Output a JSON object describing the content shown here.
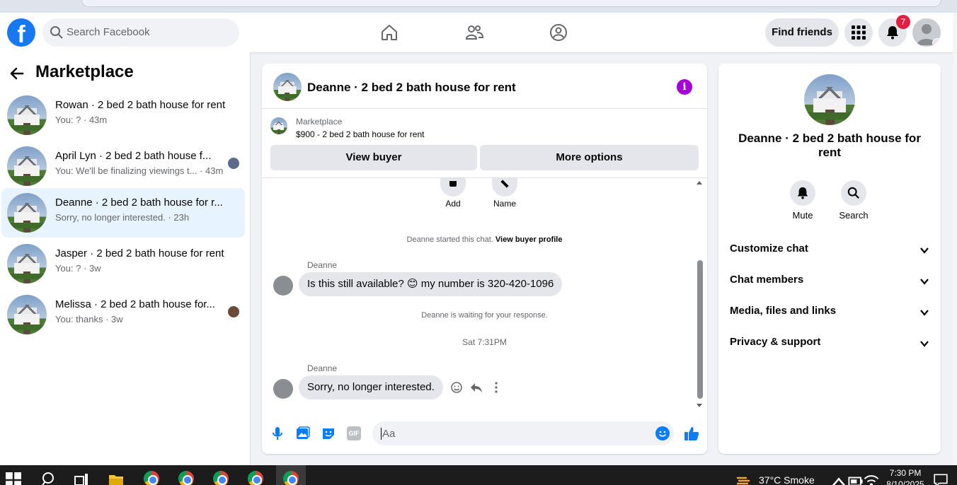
{
  "header": {
    "search_placeholder": "Search Facebook",
    "find_friends": "Find friends",
    "notification_count": "7",
    "logo_letter": "f"
  },
  "sidebar": {
    "title": "Marketplace",
    "conversations": [
      {
        "name": "Rowan · 2 bed 2 bath house for rent",
        "preview": "You: ? · 43m"
      },
      {
        "name": "April Lyn · 2 bed 2 bath house f...",
        "preview": "You: We'll be finalizing viewings t... · 43m"
      },
      {
        "name": "Deanne · 2 bed 2 bath house for r...",
        "preview": "Sorry, no longer interested. · 23h"
      },
      {
        "name": "Jasper · 2 bed 2 bath house for rent",
        "preview": "You: ? · 3w"
      },
      {
        "name": "Melissa · 2 bed 2 bath house for...",
        "preview": "You: thanks · 3w"
      }
    ]
  },
  "chat": {
    "title": "Deanne · 2 bed 2 bath house for rent",
    "info_glyph": "i",
    "listing_source": "Marketplace",
    "listing_detail": "$900 - 2 bed 2 bath house for rent",
    "view_buyer": "View buyer",
    "more_options": "More options",
    "quick_actions": {
      "add": "Add",
      "name": "Name"
    },
    "started_text": "Deanne started this chat.",
    "view_buyer_profile": "View buyer profile",
    "sender": "Deanne",
    "message1": "Is this still available? 😊 my number is 320-420-1096",
    "waiting": "Deanne is waiting for your response.",
    "timestamp": "Sat 7:31PM",
    "message2": "Sorry, no longer interested.",
    "composer_placeholder": "Aa",
    "gif_label": "GIF"
  },
  "details": {
    "title": "Deanne · 2 bed 2 bath house for rent",
    "mute": "Mute",
    "search": "Search",
    "sections": [
      "Customize chat",
      "Chat members",
      "Media, files and links",
      "Privacy & support"
    ]
  },
  "taskbar": {
    "weather": "37°C  Smoke",
    "time": "7:30 PM",
    "date": "8/10/2025"
  },
  "colors": {
    "brand_blue": "#1877f2",
    "messenger_blue": "#0a7cff",
    "info_purple": "#a400d7",
    "badge_red": "#e41e3f",
    "active_row": "#e7f3ff"
  }
}
